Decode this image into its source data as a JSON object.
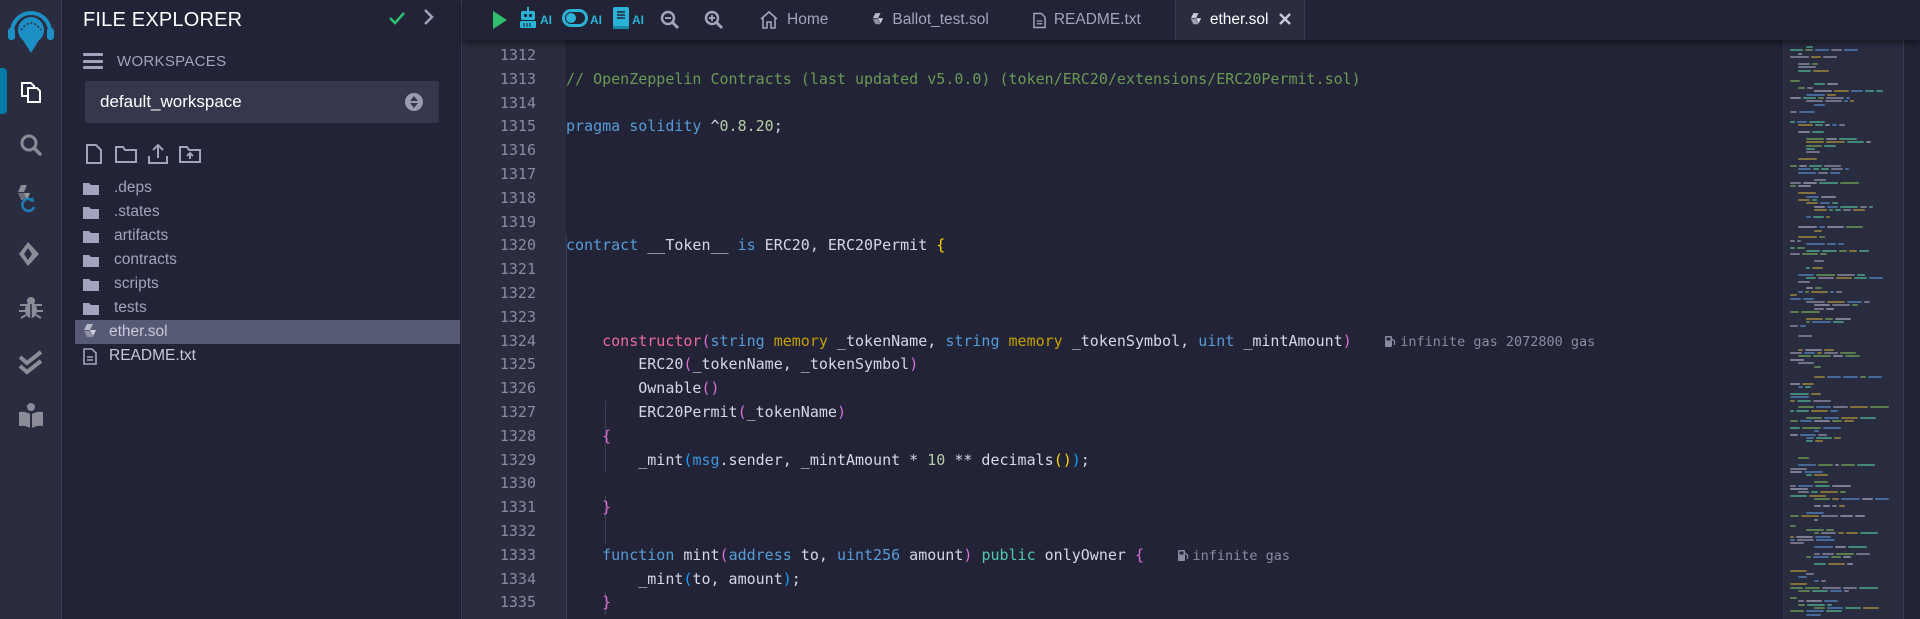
{
  "iconbar": {
    "items": [
      {
        "name": "file-explorer",
        "active": true
      },
      {
        "name": "search"
      },
      {
        "name": "solidity-compiler"
      },
      {
        "name": "deploy-run"
      },
      {
        "name": "debugger"
      },
      {
        "name": "solidity-unit-testing"
      },
      {
        "name": "learneth"
      }
    ]
  },
  "explorer": {
    "title": "FILE EXPLORER",
    "workspaces_label": "WORKSPACES",
    "workspace_selected": "default_workspace",
    "actions": [
      "new-file",
      "new-folder",
      "upload-files",
      "upload-folder"
    ],
    "tree": [
      {
        "name": ".deps",
        "type": "folder"
      },
      {
        "name": ".states",
        "type": "folder"
      },
      {
        "name": "artifacts",
        "type": "folder"
      },
      {
        "name": "contracts",
        "type": "folder"
      },
      {
        "name": "scripts",
        "type": "folder"
      },
      {
        "name": "tests",
        "type": "folder"
      },
      {
        "name": "ether.sol",
        "type": "solidity",
        "selected": true
      },
      {
        "name": "README.txt",
        "type": "text"
      }
    ]
  },
  "toolbar": {
    "ai_label": "AI",
    "tabs": [
      {
        "label": "Home",
        "icon": "home"
      },
      {
        "label": "Ballot_test.sol",
        "icon": "solidity"
      },
      {
        "label": "README.txt",
        "icon": "text"
      },
      {
        "label": "ether.sol",
        "icon": "solidity",
        "active": true
      }
    ]
  },
  "editor": {
    "lines": [
      {
        "n": "1312",
        "tokens": []
      },
      {
        "n": "1313",
        "tokens": [
          [
            "c-comment",
            "// OpenZeppelin Contracts (last updated v5.0.0) (token/ERC20/extensions/ERC20Permit.sol)"
          ]
        ]
      },
      {
        "n": "1314",
        "tokens": []
      },
      {
        "n": "1315",
        "tokens": [
          [
            "c-kw",
            "pragma"
          ],
          [
            "",
            " "
          ],
          [
            "c-kw",
            "solidity"
          ],
          [
            "",
            " ^"
          ],
          [
            "c-num",
            "0.8.20"
          ],
          [
            "",
            ";"
          ]
        ]
      },
      {
        "n": "1316",
        "tokens": []
      },
      {
        "n": "1317",
        "tokens": []
      },
      {
        "n": "1318",
        "tokens": []
      },
      {
        "n": "1319",
        "tokens": []
      },
      {
        "n": "1320",
        "tokens": [
          [
            "c-kw",
            "contract"
          ],
          [
            "",
            " __Token__ "
          ],
          [
            "c-kw",
            "is"
          ],
          [
            "",
            " ERC20, ERC20Permit "
          ],
          [
            "c-brace-y",
            "{"
          ]
        ]
      },
      {
        "n": "1321",
        "tokens": []
      },
      {
        "n": "1322",
        "tokens": []
      },
      {
        "n": "1323",
        "tokens": []
      },
      {
        "n": "1324",
        "tokens": [
          [
            "",
            "    "
          ],
          [
            "c-ctor",
            "constructor"
          ],
          [
            "c-brace-p",
            "("
          ],
          [
            "c-type",
            "string"
          ],
          [
            "",
            " "
          ],
          [
            "c-mem",
            "memory"
          ],
          [
            "",
            " _tokenName, "
          ],
          [
            "c-type",
            "string"
          ],
          [
            "",
            " "
          ],
          [
            "c-mem",
            "memory"
          ],
          [
            "",
            " _tokenSymbol, "
          ],
          [
            "c-type",
            "uint"
          ],
          [
            "",
            " _mintAmount"
          ],
          [
            "c-brace-p",
            ")"
          ]
        ],
        "gas": "infinite gas 2072800 gas"
      },
      {
        "n": "1325",
        "tokens": [
          [
            "",
            "        ERC20"
          ],
          [
            "c-brace-p",
            "("
          ],
          [
            "",
            "_tokenName, _tokenSymbol"
          ],
          [
            "c-brace-p",
            ")"
          ]
        ]
      },
      {
        "n": "1326",
        "tokens": [
          [
            "",
            "        Ownable"
          ],
          [
            "c-brace-p",
            "()"
          ]
        ]
      },
      {
        "n": "1327",
        "tokens": [
          [
            "",
            "        ERC20Permit"
          ],
          [
            "c-brace-p",
            "("
          ],
          [
            "",
            "_tokenName"
          ],
          [
            "c-brace-p",
            ")"
          ]
        ]
      },
      {
        "n": "1328",
        "tokens": [
          [
            "",
            "    "
          ],
          [
            "c-brace-p",
            "{"
          ]
        ]
      },
      {
        "n": "1329",
        "tokens": [
          [
            "",
            "        _mint"
          ],
          [
            "c-brace-b",
            "("
          ],
          [
            "c-msg",
            "msg"
          ],
          [
            "",
            ".sender, _mintAmount * "
          ],
          [
            "c-num",
            "10"
          ],
          [
            "",
            " ** decimals"
          ],
          [
            "c-brace-y",
            "()"
          ],
          [
            "c-brace-b",
            ")"
          ],
          [
            "",
            ";"
          ]
        ]
      },
      {
        "n": "1330",
        "tokens": []
      },
      {
        "n": "1331",
        "tokens": [
          [
            "",
            "    "
          ],
          [
            "c-brace-p",
            "}"
          ]
        ]
      },
      {
        "n": "1332",
        "tokens": []
      },
      {
        "n": "1333",
        "tokens": [
          [
            "",
            "    "
          ],
          [
            "c-kw",
            "function"
          ],
          [
            "",
            " mint"
          ],
          [
            "c-brace-p",
            "("
          ],
          [
            "c-type",
            "address"
          ],
          [
            "",
            " to, "
          ],
          [
            "c-type",
            "uint256"
          ],
          [
            "",
            " amount"
          ],
          [
            "c-brace-p",
            ")"
          ],
          [
            "",
            " "
          ],
          [
            "c-pub",
            "public"
          ],
          [
            "",
            " onlyOwner "
          ],
          [
            "c-brace-p",
            "{"
          ]
        ],
        "gas": "infinite gas"
      },
      {
        "n": "1334",
        "tokens": [
          [
            "",
            "        _mint"
          ],
          [
            "c-brace-b",
            "("
          ],
          [
            "",
            "to, amount"
          ],
          [
            "c-brace-b",
            ")"
          ],
          [
            "",
            ";"
          ]
        ]
      },
      {
        "n": "1335",
        "tokens": [
          [
            "",
            "    "
          ],
          [
            "c-brace-p",
            "}"
          ]
        ]
      }
    ]
  },
  "colors": {
    "accent": "#007aa6",
    "ai_cyan": "#2ab3d6",
    "run_green": "#2fbf71",
    "background": "#222336",
    "panel": "#2a2c3f"
  }
}
